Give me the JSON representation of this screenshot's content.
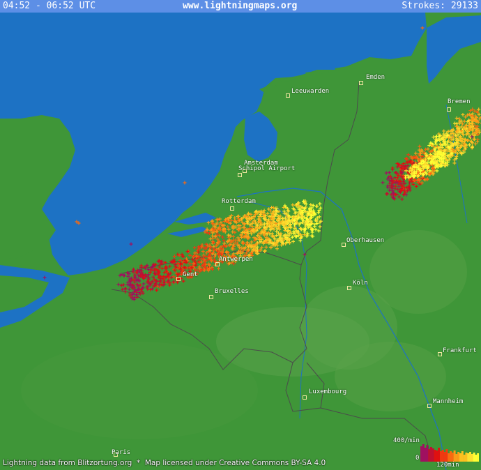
{
  "header": {
    "time_range": "04:52 - 06:52 UTC",
    "site": "www.lightningmaps.org",
    "strokes_label": "Strokes: 29133"
  },
  "footer": {
    "attribution": "Lightning data from Blitzortung.org  *  Map licensed under Creative Commons BY-SA 4.0"
  },
  "cities": [
    {
      "name": "Emden"
    },
    {
      "name": "Leeuwarden"
    },
    {
      "name": "Bremen"
    },
    {
      "name": "Amsterdam"
    },
    {
      "name": "Schipol Airport"
    },
    {
      "name": "Rotterdam"
    },
    {
      "name": "Oberhausen"
    },
    {
      "name": "Antwerpen"
    },
    {
      "name": "Gent"
    },
    {
      "name": "Köln"
    },
    {
      "name": "Bruxelles"
    },
    {
      "name": "Frankfurt"
    },
    {
      "name": "Luxembourg"
    },
    {
      "name": "Mannheim"
    },
    {
      "name": "Paris"
    }
  ],
  "legend": {
    "rate_label": "400/min",
    "zero_label": "0",
    "time_label": "120min"
  },
  "colors": {
    "sea": "#1d72c4",
    "land": "#3f9638",
    "header_bar": "#5d8fe6",
    "stroke_recent": "#ffff33",
    "stroke_old": "#a01060"
  }
}
